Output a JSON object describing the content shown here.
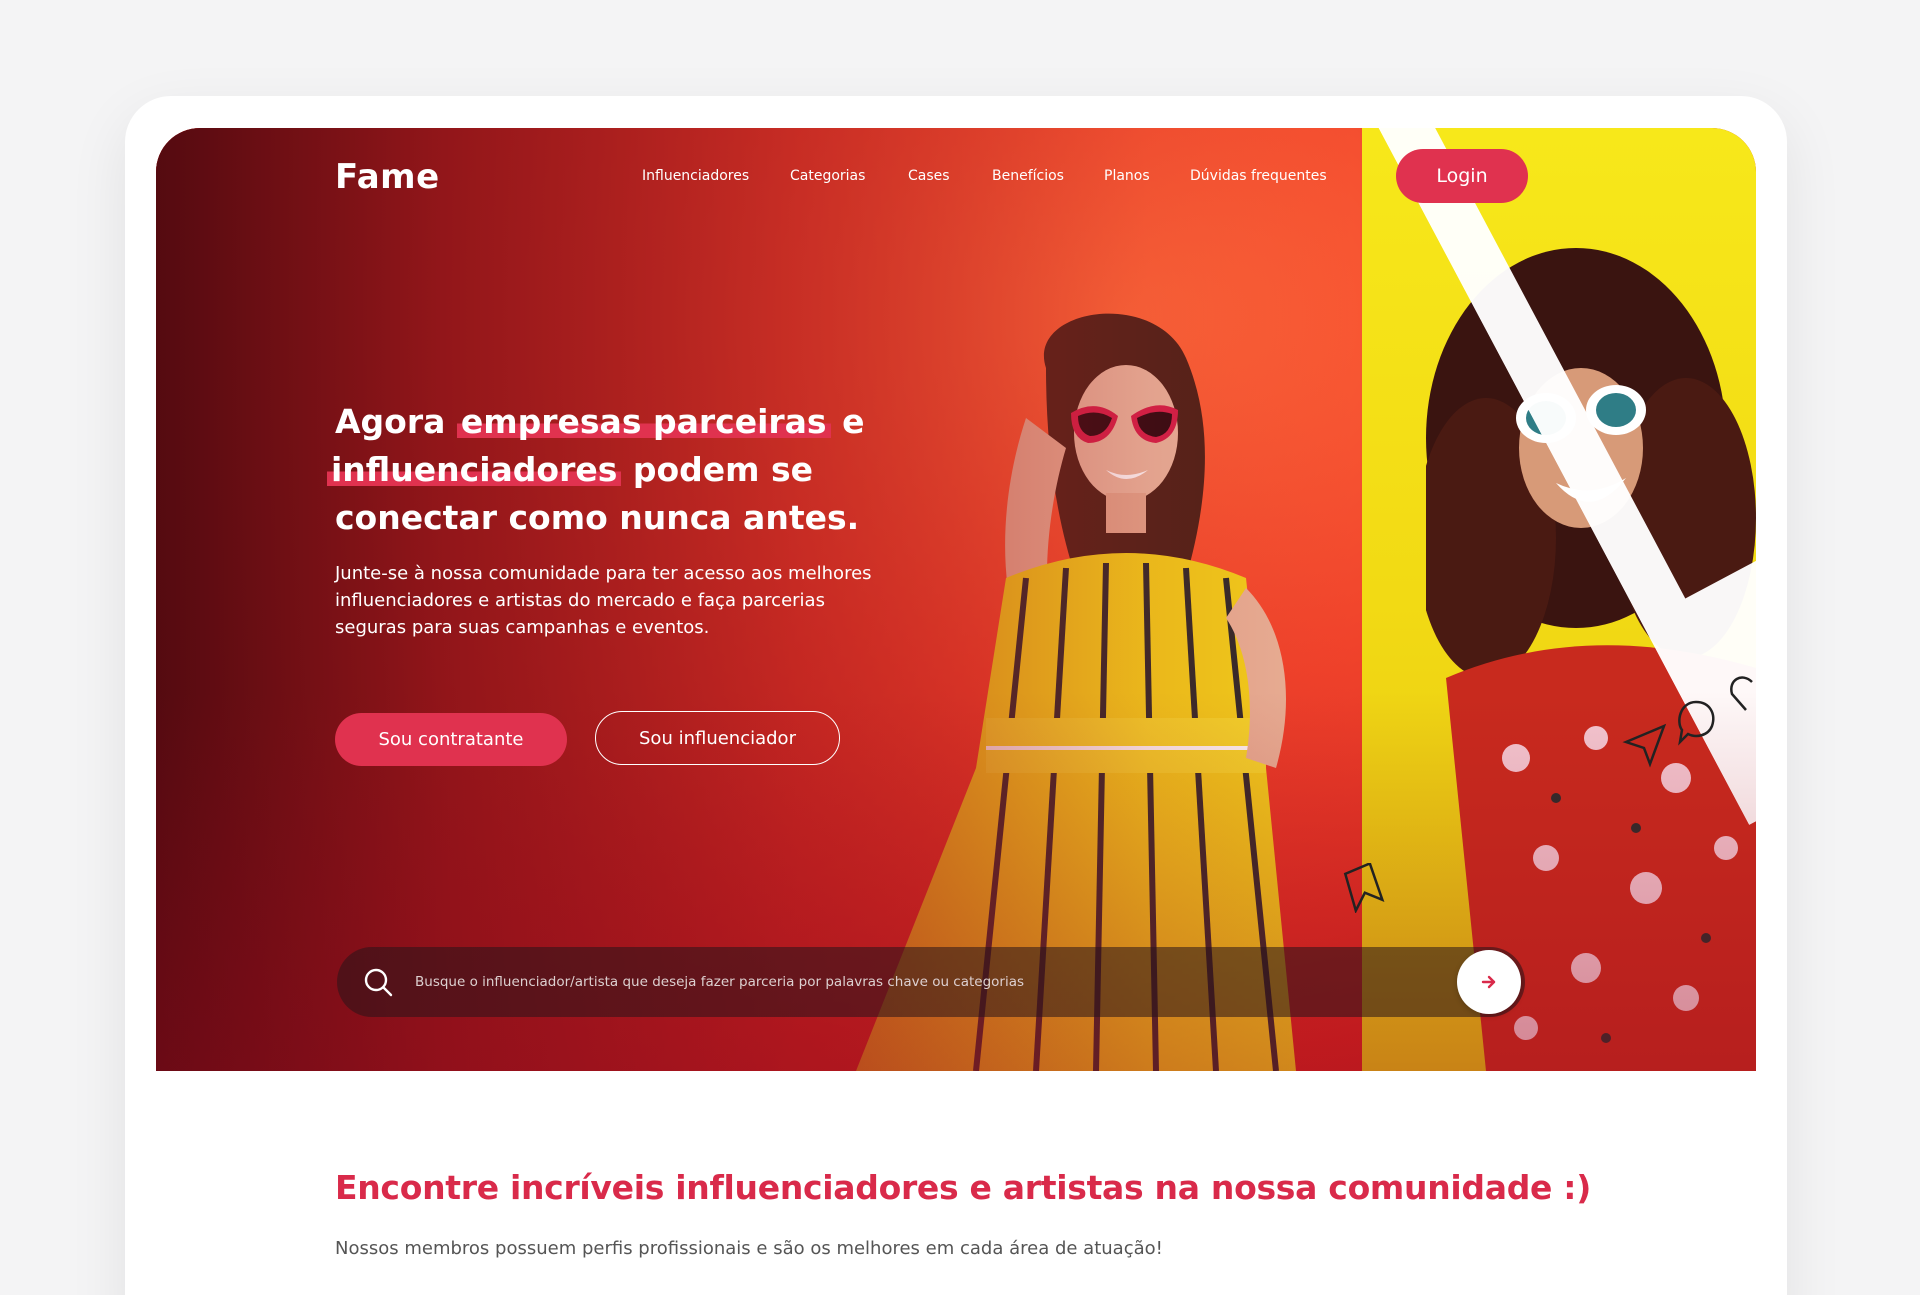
{
  "nav": {
    "logo": "Fame",
    "items": [
      {
        "label": "Influenciadores"
      },
      {
        "label": "Categorias"
      },
      {
        "label": "Cases"
      },
      {
        "label": "Benefícios"
      },
      {
        "label": "Planos"
      },
      {
        "label": "Dúvidas frequentes"
      }
    ],
    "login_label": "Login"
  },
  "hero": {
    "headline_part1": "Agora ",
    "headline_highlight1": "empresas parceiras",
    "headline_part2": " e ",
    "headline_highlight2": "influenciadores",
    "headline_part3": " podem se conectar como nunca antes.",
    "subtext": "Junte-se à nossa comunidade para ter acesso aos melhores influenciadores e artistas do mercado e faça parcerias seguras para suas campanhas e eventos.",
    "primary_button": "Sou contratante",
    "secondary_button": "Sou influenciador"
  },
  "search": {
    "placeholder": "Busque o influenciador/artista que deseja fazer parceria por palavras chave ou categorias",
    "value": ""
  },
  "section": {
    "title": "Encontre incríveis influenciadores e artistas na nossa comunidade :)",
    "subtitle": "Nossos membros possuem perfis profissionais e são os melhores em cada área de atuação!"
  },
  "colors": {
    "accent": "#e0324f",
    "title": "#d92a4a",
    "yellow": "#f2da14"
  }
}
